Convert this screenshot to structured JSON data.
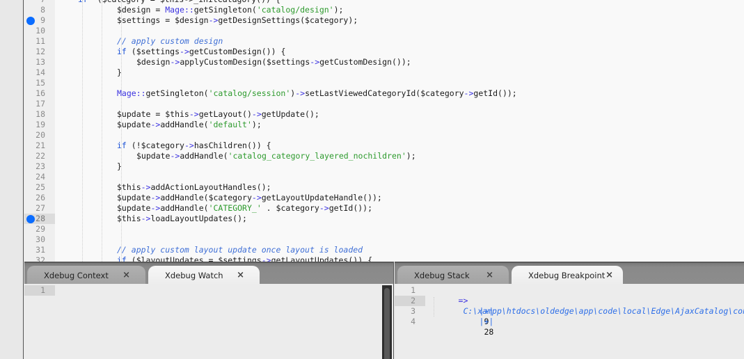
{
  "editor": {
    "breakpoint_color": "#0a6cff",
    "lines": [
      {
        "n": "7",
        "indent": 0,
        "segments": [
          [
            "c-kw",
            "if"
          ],
          [
            "",
            "  ($category = $this->_initCatagory()) {"
          ]
        ],
        "partial": true
      },
      {
        "n": "8",
        "indent": 1,
        "bp": false,
        "segments": [
          [
            "",
            "$design = "
          ],
          [
            "c-cls",
            "Mage::"
          ],
          [
            "",
            "getSingleton("
          ],
          [
            "c-str",
            "'catalog/design'"
          ],
          [
            "",
            ");"
          ]
        ]
      },
      {
        "n": "9",
        "indent": 1,
        "bp": true,
        "segments": [
          [
            "",
            "$settings = $design"
          ],
          [
            "c-op",
            "->"
          ],
          [
            "",
            "getDesignSettings($category);"
          ]
        ]
      },
      {
        "n": "10",
        "indent": 1,
        "segments": []
      },
      {
        "n": "11",
        "indent": 1,
        "segments": [
          [
            "c-cmt",
            "// apply custom design"
          ]
        ]
      },
      {
        "n": "12",
        "indent": 1,
        "segments": [
          [
            "c-kw",
            "if"
          ],
          [
            "",
            " ($settings"
          ],
          [
            "c-op",
            "->"
          ],
          [
            "",
            "getCustomDesign()) {"
          ]
        ]
      },
      {
        "n": "13",
        "indent": 2,
        "segments": [
          [
            "",
            "$design"
          ],
          [
            "c-op",
            "->"
          ],
          [
            "",
            "applyCustomDesign($settings"
          ],
          [
            "c-op",
            "->"
          ],
          [
            "",
            "getCustomDesign());"
          ]
        ]
      },
      {
        "n": "14",
        "indent": 1,
        "segments": [
          [
            "",
            "}"
          ]
        ]
      },
      {
        "n": "15",
        "indent": 1,
        "segments": []
      },
      {
        "n": "16",
        "indent": 1,
        "segments": [
          [
            "c-cls",
            "Mage::"
          ],
          [
            "",
            "getSingleton("
          ],
          [
            "c-str",
            "'catalog/session'"
          ],
          [
            "",
            ")"
          ],
          [
            "c-op",
            "->"
          ],
          [
            "",
            "setLastViewedCategoryId($category"
          ],
          [
            "c-op",
            "->"
          ],
          [
            "",
            "getId());"
          ]
        ]
      },
      {
        "n": "17",
        "indent": 1,
        "segments": []
      },
      {
        "n": "18",
        "indent": 1,
        "segments": [
          [
            "",
            "$update = $this"
          ],
          [
            "c-op",
            "->"
          ],
          [
            "",
            "getLayout()"
          ],
          [
            "c-op",
            "->"
          ],
          [
            "",
            "getUpdate();"
          ]
        ]
      },
      {
        "n": "19",
        "indent": 1,
        "segments": [
          [
            "",
            "$update"
          ],
          [
            "c-op",
            "->"
          ],
          [
            "",
            "addHandle("
          ],
          [
            "c-str",
            "'default'"
          ],
          [
            "",
            ");"
          ]
        ]
      },
      {
        "n": "20",
        "indent": 1,
        "segments": []
      },
      {
        "n": "21",
        "indent": 1,
        "segments": [
          [
            "c-kw",
            "if"
          ],
          [
            "",
            " (!$category"
          ],
          [
            "c-op",
            "->"
          ],
          [
            "",
            "hasChildren()) {"
          ]
        ]
      },
      {
        "n": "22",
        "indent": 2,
        "segments": [
          [
            "",
            "$update"
          ],
          [
            "c-op",
            "->"
          ],
          [
            "",
            "addHandle("
          ],
          [
            "c-str",
            "'catalog_category_layered_nochildren'"
          ],
          [
            "",
            ");"
          ]
        ]
      },
      {
        "n": "23",
        "indent": 1,
        "segments": [
          [
            "",
            "}"
          ]
        ]
      },
      {
        "n": "24",
        "indent": 1,
        "segments": []
      },
      {
        "n": "25",
        "indent": 1,
        "segments": [
          [
            "",
            "$this"
          ],
          [
            "c-op",
            "->"
          ],
          [
            "",
            "addActionLayoutHandles();"
          ]
        ]
      },
      {
        "n": "26",
        "indent": 1,
        "segments": [
          [
            "",
            "$update"
          ],
          [
            "c-op",
            "->"
          ],
          [
            "",
            "addHandle($category"
          ],
          [
            "c-op",
            "->"
          ],
          [
            "",
            "getLayoutUpdateHandle());"
          ]
        ]
      },
      {
        "n": "27",
        "indent": 1,
        "segments": [
          [
            "",
            "$update"
          ],
          [
            "c-op",
            "->"
          ],
          [
            "",
            "addHandle("
          ],
          [
            "c-str",
            "'CATEGORY_'"
          ],
          [
            "",
            " . $category"
          ],
          [
            "c-op",
            "->"
          ],
          [
            "",
            "getId());"
          ]
        ]
      },
      {
        "n": "28",
        "indent": 1,
        "bp": true,
        "active": true,
        "segments": [
          [
            "",
            "$this"
          ],
          [
            "c-op",
            "->"
          ],
          [
            "",
            "loadLayoutUpdates();"
          ]
        ]
      },
      {
        "n": "29",
        "indent": 1,
        "segments": []
      },
      {
        "n": "30",
        "indent": 1,
        "segments": []
      },
      {
        "n": "31",
        "indent": 1,
        "segments": [
          [
            "c-cmt",
            "// apply custom layout update once layout is loaded"
          ]
        ]
      },
      {
        "n": "32",
        "indent": 1,
        "segments": [
          [
            "c-kw",
            "if"
          ],
          [
            "",
            " ($layoutUpdates = $settings"
          ],
          [
            "c-op",
            "->"
          ],
          [
            "",
            "getLayoutUpdates()) {"
          ]
        ]
      }
    ]
  },
  "left_panel": {
    "tabs": [
      {
        "label": "Xdebug Context",
        "close": "×",
        "active": false
      },
      {
        "label": "Xdebug Watch",
        "close": "×",
        "active": true
      }
    ],
    "line_numbers": [
      "1"
    ]
  },
  "right_panel": {
    "tabs": [
      {
        "label": "Xdebug Stack",
        "close": "×",
        "active": false
      },
      {
        "label": "Xdebug Breakpoint",
        "close": "×",
        "active": true
      }
    ],
    "line_numbers": [
      "1",
      "2",
      "3",
      "4"
    ],
    "breakpoints": {
      "arrow": "=>",
      "file_path": "C:\\xampp\\htdocs\\oldedge\\app\\code\\local\\Edge\\AjaxCatalog\\controllers\\CategoryController.php",
      "toggle_label": "|+|",
      "lines": [
        "9",
        "28"
      ]
    }
  }
}
